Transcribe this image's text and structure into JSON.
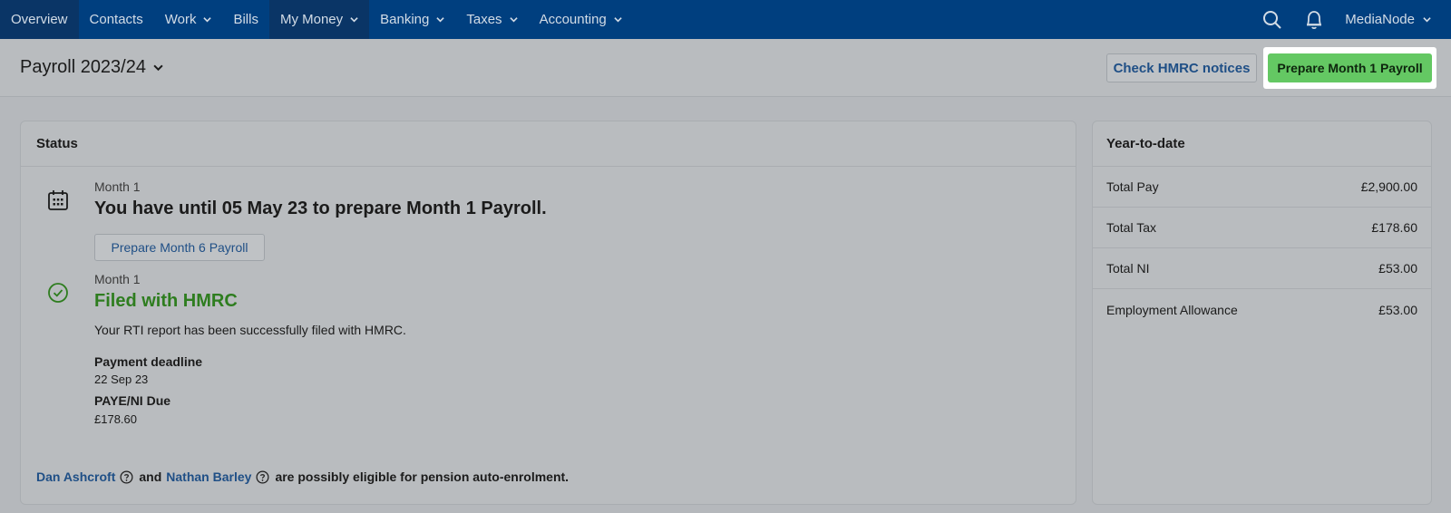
{
  "nav": {
    "items": [
      {
        "label": "Overview",
        "active": true,
        "dropdown": false
      },
      {
        "label": "Contacts",
        "active": false,
        "dropdown": false
      },
      {
        "label": "Work",
        "active": false,
        "dropdown": true
      },
      {
        "label": "Bills",
        "active": false,
        "dropdown": false
      },
      {
        "label": "My Money",
        "active": true,
        "dropdown": true
      },
      {
        "label": "Banking",
        "active": false,
        "dropdown": true
      },
      {
        "label": "Taxes",
        "active": false,
        "dropdown": true
      },
      {
        "label": "Accounting",
        "active": false,
        "dropdown": true
      }
    ],
    "user": "MediaNode"
  },
  "header": {
    "title": "Payroll 2023/24",
    "check_hmrc": "Check HMRC notices",
    "prepare": "Prepare Month 1 Payroll"
  },
  "status": {
    "heading": "Status",
    "item1": {
      "period": "Month 1",
      "title": "You have until 05 May 23 to prepare Month 1 Payroll.",
      "button": "Prepare Month 6 Payroll"
    },
    "item2": {
      "period": "Month 1",
      "title": "Filed with HMRC",
      "text": "Your RTI report has been successfully filed with HMRC.",
      "deadline_label": "Payment deadline",
      "deadline_value": "22 Sep 23",
      "due_label": "PAYE/NI Due",
      "due_value": "£178.60"
    },
    "pension": {
      "person1": "Dan Ashcroft",
      "and": "and",
      "person2": "Nathan Barley",
      "suffix": "are possibly eligible for pension auto-enrolment."
    }
  },
  "ytd": {
    "heading": "Year-to-date",
    "rows": [
      {
        "label": "Total Pay",
        "value": "£2,900.00"
      },
      {
        "label": "Total Tax",
        "value": "£178.60"
      },
      {
        "label": "Total NI",
        "value": "£53.00"
      },
      {
        "label": "Employment Allowance",
        "value": "£53.00"
      }
    ]
  }
}
